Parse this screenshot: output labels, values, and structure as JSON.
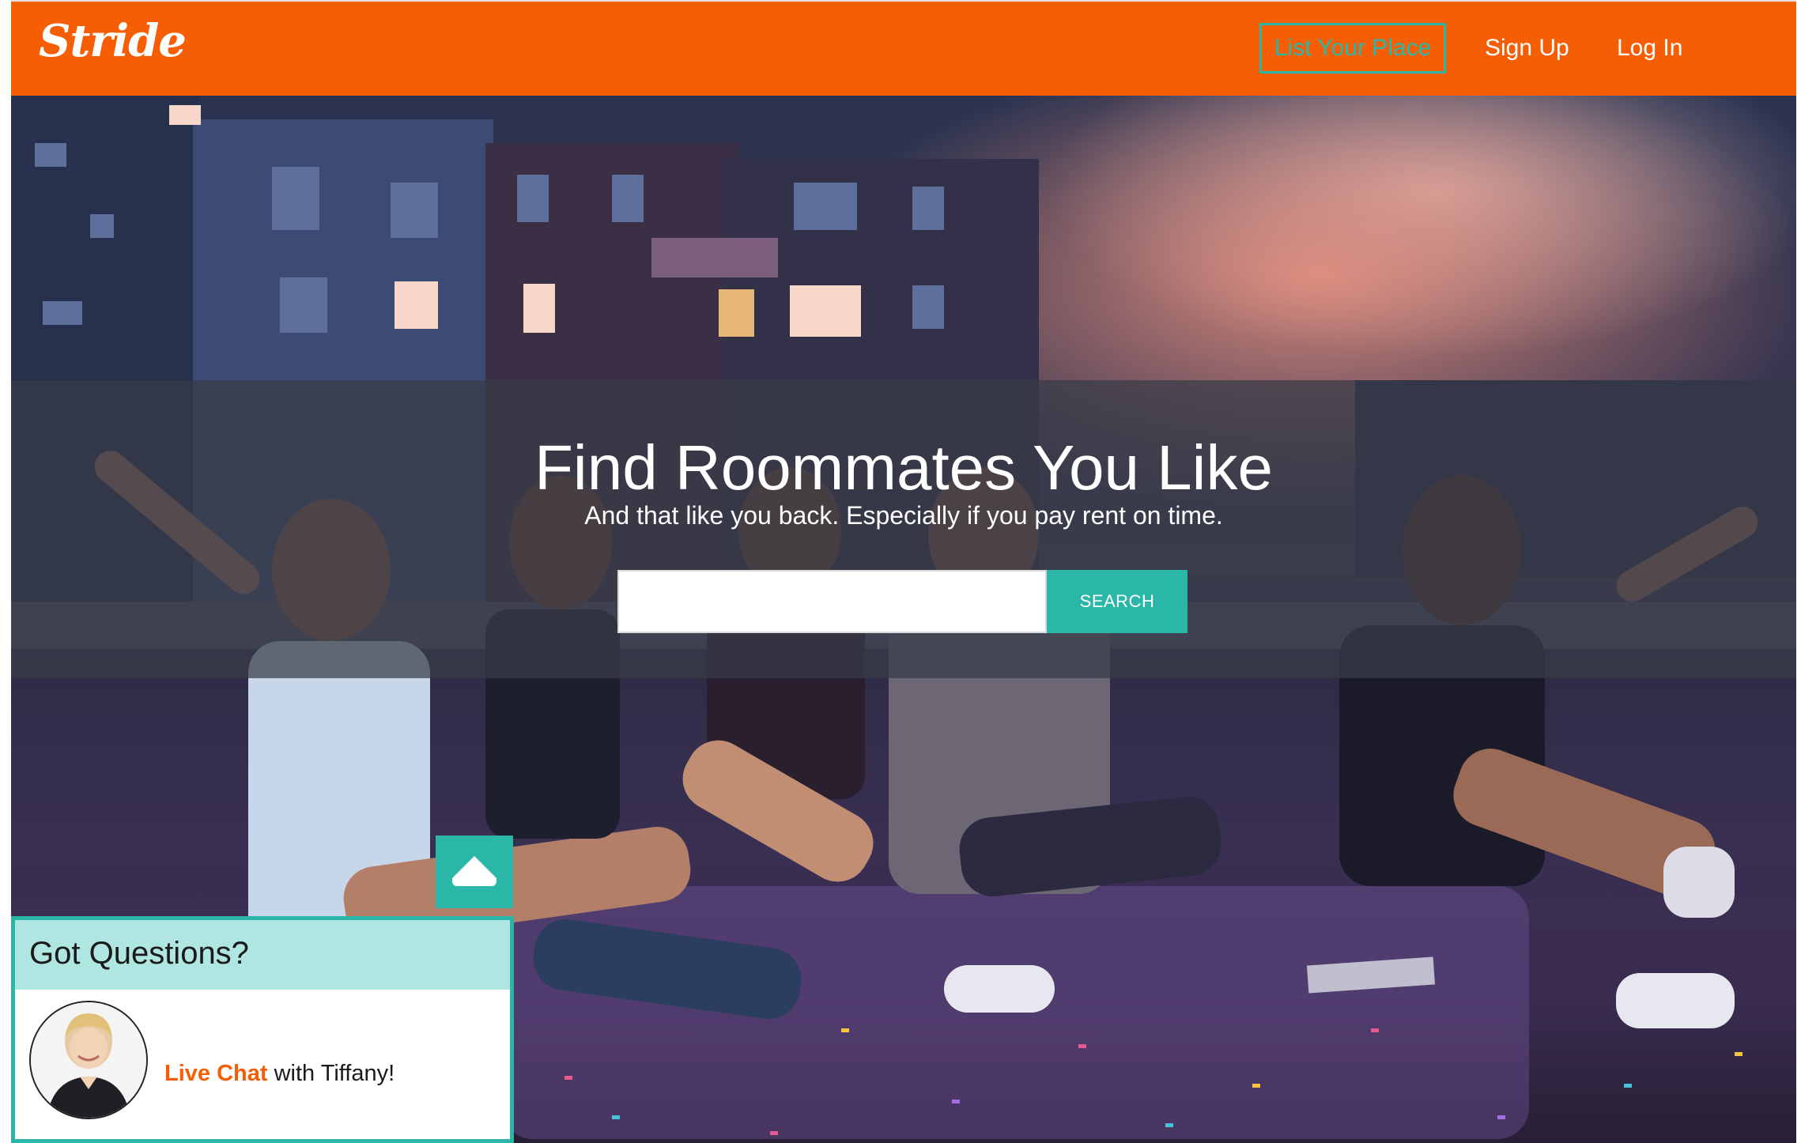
{
  "header": {
    "logo": "Stride",
    "nav": {
      "list_place": "List Your Place",
      "sign_up": "Sign Up",
      "log_in": "Log In"
    }
  },
  "hero": {
    "title": "Find Roommates You Like",
    "subtitle": "And that like you back. Especially if you pay rent on time.",
    "search": {
      "value": "",
      "placeholder": "",
      "button_label": "SEARCH"
    }
  },
  "chat": {
    "title": "Got Questions?",
    "link_label": "Live Chat",
    "text_suffix": " with Tiffany!"
  },
  "colors": {
    "brand_orange": "#f65e06",
    "accent_teal": "#2bb7a8",
    "chat_header_bg": "#b0e6e1"
  },
  "icons": {
    "chat_toggle": "chevron-up-icon",
    "avatar": "agent-photo"
  }
}
